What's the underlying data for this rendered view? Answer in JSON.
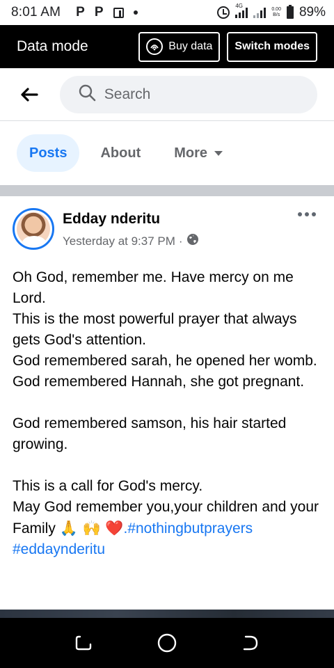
{
  "status_bar": {
    "time": "8:01 AM",
    "left_icons": [
      "P",
      "P"
    ],
    "network_label": "4G",
    "net_speed": "0.00",
    "net_unit": "B/s",
    "battery": "89%"
  },
  "banner": {
    "title": "Data mode",
    "buy_label": "Buy data",
    "switch_label": "Switch modes",
    "background": "#000000"
  },
  "search": {
    "placeholder": "Search"
  },
  "tabs": [
    {
      "label": "Posts",
      "active": true
    },
    {
      "label": "About",
      "active": false
    },
    {
      "label": "More",
      "active": false
    }
  ],
  "post": {
    "author": "Edday nderitu",
    "timestamp": "Yesterday at 9:37 PM",
    "separator": "·",
    "lines": [
      "Oh God, remember me. Have mercy on me Lord.",
      "This is the most powerful prayer that always gets God's attention.",
      "God remembered sarah, he opened her womb.",
      "God remembered Hannah, she got pregnant."
    ],
    "para2": "God remembered samson, his hair started growing.",
    "para3_line1": "This is a call for God's mercy.",
    "para3_line2": "May God remember you,your children and your Family",
    "emojis": "🙏 🙌 ❤️",
    "hashtag1": ".#nothingbutprayers",
    "hashtag2": "#eddaynderitu"
  },
  "colors": {
    "accent": "#1877f2",
    "active_tab_bg": "#e7f3ff",
    "muted_text": "#65676b",
    "divider": "#c9ccd1"
  },
  "icons": {
    "back": "arrow-left-icon",
    "search": "search-icon",
    "privacy": "globe-icon",
    "more": "ellipsis-icon",
    "nav": [
      "recent-apps-icon",
      "home-icon",
      "back-icon"
    ]
  }
}
